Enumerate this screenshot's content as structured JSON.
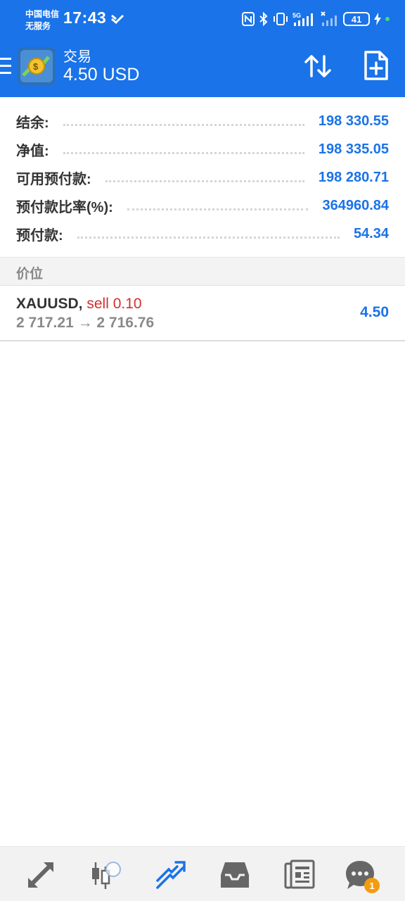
{
  "status_bar": {
    "carrier_line1": "中国电信",
    "carrier_line2": "无服务",
    "time": "17:43",
    "battery": "41",
    "network": "5G"
  },
  "app_bar": {
    "title": "交易",
    "subtitle": "4.50 USD"
  },
  "account": {
    "rows": [
      {
        "label": "结余:",
        "value": "198 330.55"
      },
      {
        "label": "净值:",
        "value": "198 335.05"
      },
      {
        "label": "可用预付款:",
        "value": "198 280.71"
      },
      {
        "label": "预付款比率(%):",
        "value": "364960.84"
      },
      {
        "label": "预付款:",
        "value": "54.34"
      }
    ]
  },
  "positions_section": {
    "title": "价位"
  },
  "positions": [
    {
      "symbol": "XAUUSD,",
      "side_volume": "sell 0.10",
      "prices": "2 717.21 → 2 716.76",
      "profit": "4.50"
    }
  ],
  "bottom_nav": {
    "items": [
      "quotes-icon",
      "chart-icon",
      "trade-icon",
      "history-icon",
      "news-icon",
      "messages-icon"
    ],
    "active": "trade-icon",
    "messages_badge": "1"
  },
  "colors": {
    "primary": "#1a73e8",
    "sell": "#d32f2f",
    "badge": "#f39c12"
  }
}
